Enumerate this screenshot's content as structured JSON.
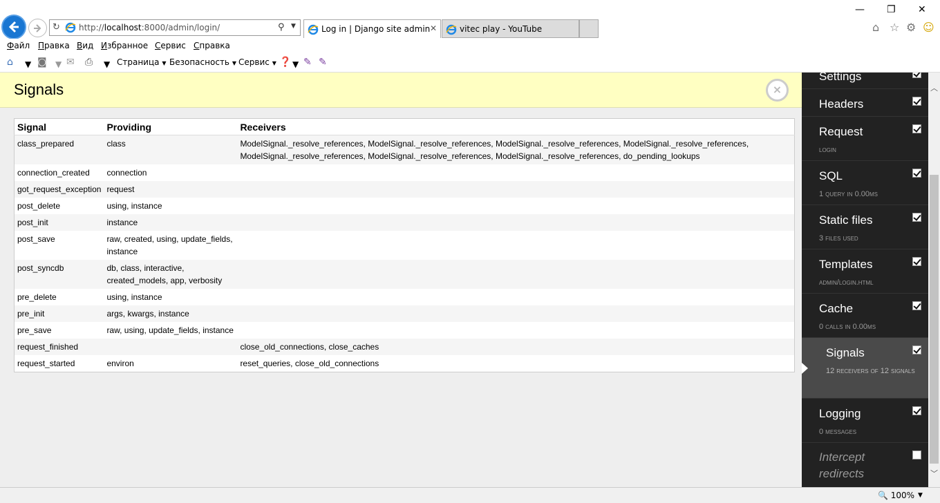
{
  "browser": {
    "url_prefix": "http://",
    "url_host": "localhost",
    "url_rest": ":8000/admin/login/",
    "tabs": [
      {
        "label": "Log in | Django site admin",
        "close": "✕"
      },
      {
        "label": "vitec play - YouTube"
      }
    ],
    "window_controls": {
      "minimize": "—",
      "restore": "❐",
      "close": "✕"
    }
  },
  "menu": [
    "Файл",
    "Правка",
    "Вид",
    "Избранное",
    "Сервис",
    "Справка"
  ],
  "commandbar": {
    "page": "Страница",
    "safety": "Безопасность",
    "tools": "Сервис"
  },
  "panel": {
    "title": "Signals",
    "close_glyph": "×",
    "columns": [
      "Signal",
      "Providing",
      "Receivers"
    ],
    "rows": [
      {
        "signal": "class_prepared",
        "providing": "class",
        "receivers": "ModelSignal._resolve_references, ModelSignal._resolve_references, ModelSignal._resolve_references, ModelSignal._resolve_references, ModelSignal._resolve_references, ModelSignal._resolve_references, ModelSignal._resolve_references, do_pending_lookups"
      },
      {
        "signal": "connection_created",
        "providing": "connection",
        "receivers": ""
      },
      {
        "signal": "got_request_exception",
        "providing": "request",
        "receivers": ""
      },
      {
        "signal": "post_delete",
        "providing": "using, instance",
        "receivers": ""
      },
      {
        "signal": "post_init",
        "providing": "instance",
        "receivers": ""
      },
      {
        "signal": "post_save",
        "providing": "raw, created, using, update_fields, instance",
        "receivers": ""
      },
      {
        "signal": "post_syncdb",
        "providing": "db, class, interactive, created_models, app, verbosity",
        "receivers": ""
      },
      {
        "signal": "pre_delete",
        "providing": "using, instance",
        "receivers": ""
      },
      {
        "signal": "pre_init",
        "providing": "args, kwargs, instance",
        "receivers": ""
      },
      {
        "signal": "pre_save",
        "providing": "raw, using, update_fields, instance",
        "receivers": ""
      },
      {
        "signal": "request_finished",
        "providing": "",
        "receivers": "close_old_connections, close_caches"
      },
      {
        "signal": "request_started",
        "providing": "environ",
        "receivers": "reset_queries, close_old_connections"
      }
    ]
  },
  "toolbar": {
    "items": [
      {
        "name": "Settings",
        "sub": "",
        "checked": true
      },
      {
        "name": "Headers",
        "sub": "",
        "checked": true
      },
      {
        "name": "Request",
        "sub": "LOGIN",
        "checked": true
      },
      {
        "name": "SQL",
        "sub": "1 QUERY IN 0.00MS",
        "checked": true
      },
      {
        "name": "Static files",
        "sub": "3 FILES USED",
        "checked": true
      },
      {
        "name": "Templates",
        "sub": "ADMIN/LOGIN.HTML",
        "checked": true
      },
      {
        "name": "Cache",
        "sub": "0 CALLS IN 0.00MS",
        "checked": true
      },
      {
        "name": "Signals",
        "sub": "12 RECEIVERS OF 12 SIGNALS",
        "checked": true
      },
      {
        "name": "Logging",
        "sub": "0 MESSAGES",
        "checked": true
      },
      {
        "name": "Intercept redirects",
        "sub": "",
        "checked": false
      }
    ]
  },
  "status": {
    "zoom": "100%"
  }
}
